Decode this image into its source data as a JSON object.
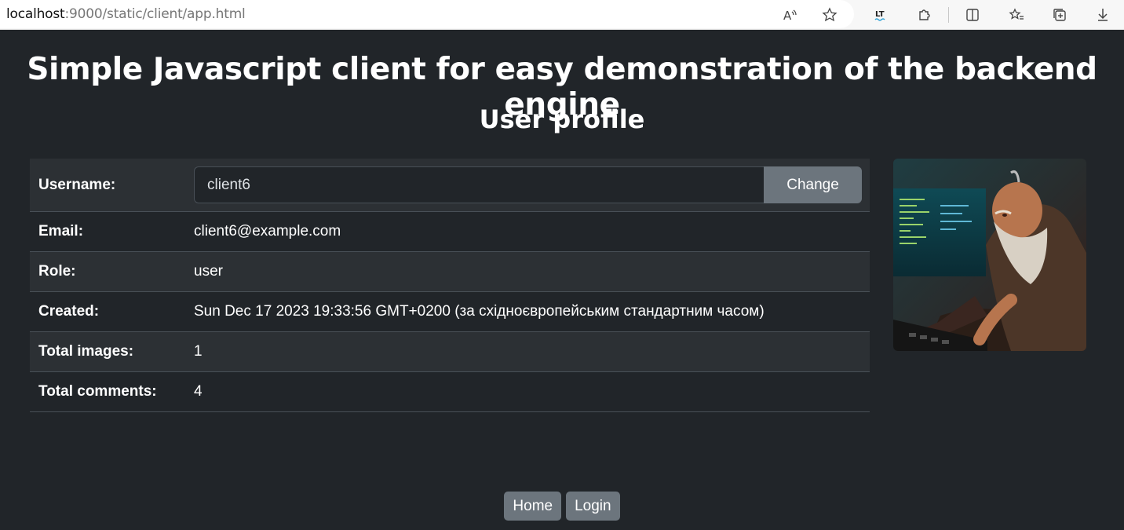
{
  "browser": {
    "url_host": "localhost",
    "url_rest": ":9000/static/client/app.html"
  },
  "page": {
    "title": "Simple Javascript client for easy demonstration of the backend engine",
    "subtitle": "User profile"
  },
  "profile": {
    "username_label": "Username:",
    "username_value": "client6",
    "change_label": "Change",
    "email_label": "Email:",
    "email_value": "client6@example.com",
    "role_label": "Role:",
    "role_value": "user",
    "created_label": "Created:",
    "created_value": "Sun Dec 17 2023 19:33:56 GMT+0200 (за східноєвропейським стандартним часом)",
    "images_label": "Total images:",
    "images_value": "1",
    "comments_label": "Total comments:",
    "comments_value": "4"
  },
  "nav": {
    "home_label": "Home",
    "login_label": "Login"
  },
  "colors": {
    "background": "#212529",
    "stripe": "#2c3034",
    "button": "#6c757d"
  }
}
